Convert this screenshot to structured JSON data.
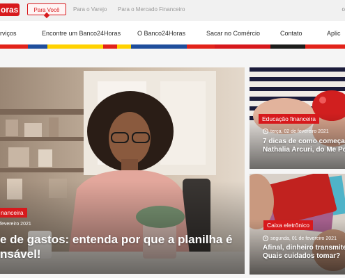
{
  "brand": {
    "logo_text": "oras",
    "red": "#d7191c"
  },
  "audience_tabs": [
    "Para Você",
    "Para o Varejo",
    "Para o Mercado Financeiro"
  ],
  "top_util": "o",
  "nav": {
    "items": [
      "rviços",
      "Encontre um Banco24Horas",
      "O Banco24Horas",
      "Sacar no Comércio",
      "Contato",
      "Aplic"
    ]
  },
  "stripe_colors": [
    "#e2231a",
    "#1f4e9c",
    "#ffd200",
    "#e2231a",
    "#ffd200",
    "#1f4e9c",
    "#e2231a",
    "#d7191c",
    "#1d1d1b",
    "#e2231a"
  ],
  "featured": {
    "category": "nanceira",
    "date": "fevereiro 2021",
    "title_line1": "e de gastos: entenda por que a planilha é",
    "title_line2": "nsável!"
  },
  "side_articles": [
    {
      "category": "Educação financeira",
      "date": "terça, 02 de fevereiro 2021",
      "title_line1": "7 dicas de como começar",
      "title_line2": "Nathalia Arcuri, do Me Pou"
    },
    {
      "category": "Caixa eletrônico",
      "date": "segunda, 01 de fevereiro 2021",
      "title_line1": "Afinal, dinheiro transmite c",
      "title_line2": "Quais cuidados tomar?"
    }
  ]
}
